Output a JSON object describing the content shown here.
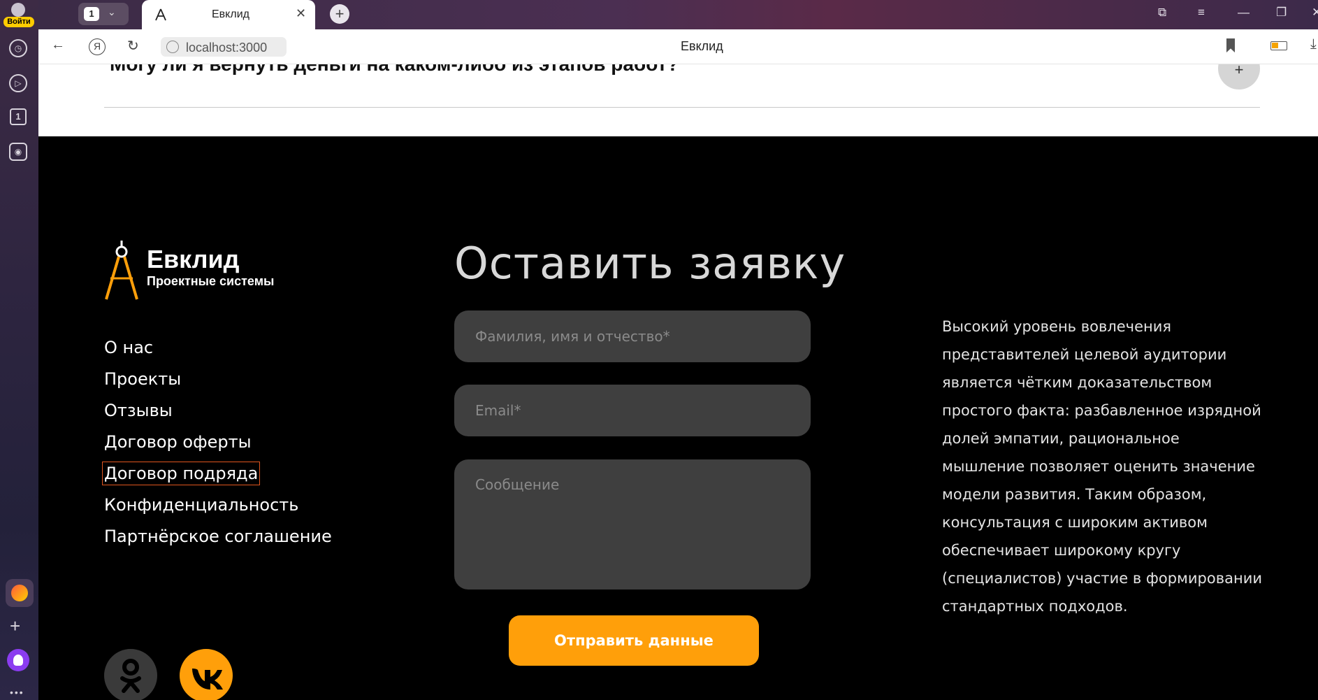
{
  "browser": {
    "login_label": "Войти",
    "tab_count": "1",
    "tab_title": "Евклид",
    "new_tab_symbol": "+",
    "url": "localhost:3000",
    "page_title": "Евклид",
    "sidebar_tab_count": "1"
  },
  "faq": {
    "question": "Могу ли я вернуть деньги на каком-либо из этапов работ?",
    "toggle_symbol": "+"
  },
  "logo": {
    "name": "Евклид",
    "subtitle": "Проектные системы"
  },
  "nav": {
    "items": [
      "О нас",
      "Проекты",
      "Отзывы",
      "Договор оферты",
      "Договор подряда",
      "Конфиденциальность",
      "Партнёрское соглашение"
    ]
  },
  "form": {
    "title": "Оставить заявку",
    "name_placeholder": "Фамилия, имя и отчество*",
    "email_placeholder": "Email*",
    "message_placeholder": "Сообщение",
    "submit_label": "Отправить данные"
  },
  "about": {
    "text": "Высокий уровень вовлечения представителей целевой аудитории является чётким доказательством простого факта: разбавленное изрядной долей эмпатии, рациональное мышление позволяет оценить значение модели развития. Таким образом, консультация с широким активом обеспечивает широкому кругу (специалистов) участие в формировании стандартных подходов."
  },
  "social": {
    "items": [
      "odnoklassniki-icon",
      "vk-icon"
    ],
    "colors": {
      "odnoklassniki": "#3a3a3a",
      "vk": "#ff9f0a"
    }
  },
  "colors": {
    "accent": "#ff9f0a",
    "field_bg": "#3f3f3f",
    "footer_bg": "#000000",
    "focus_outline": "#e0561f"
  }
}
